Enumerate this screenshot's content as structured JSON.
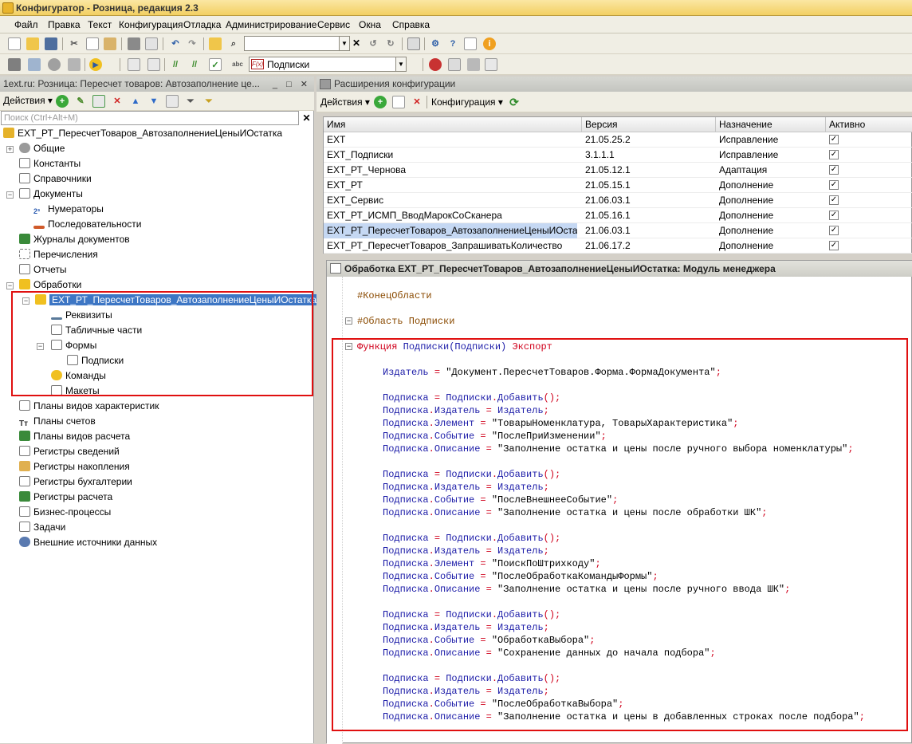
{
  "app": {
    "title": "Конфигуратор - Розница, редакция 2.3"
  },
  "menu": [
    "Файл",
    "Правка",
    "Текст",
    "Конфигурация",
    "Отладка",
    "Администрирование",
    "Сервис",
    "Окна",
    "Справка"
  ],
  "toolbar": {
    "subscriptions_combo": "Подписки",
    "fx_label": "F(x)"
  },
  "left_panel": {
    "title": "1ext.ru: Розница: Пересчет товаров: Автозаполнение це...",
    "actions_label": "Действия",
    "search_placeholder": "Поиск (Ctrl+Alt+M)",
    "root": "EXT_РТ_ПересчетТоваров_АвтозаполнениеЦеныИОстатка",
    "items": {
      "general": "Общие",
      "constants": "Константы",
      "catalogs": "Справочники",
      "documents": "Документы",
      "numerators": "Нумераторы",
      "sequences": "Последовательности",
      "doc_journals": "Журналы документов",
      "enums": "Перечисления",
      "reports": "Отчеты",
      "processing": "Обработки",
      "selected_processing": "EXT_РТ_ПересчетТоваров_АвтозаполнениеЦеныИОстатка",
      "attributes": "Реквизиты",
      "tabular_parts": "Табличные части",
      "forms": "Формы",
      "form_subscriptions": "Подписки",
      "commands": "Команды",
      "templates": "Макеты",
      "chart_char_types": "Планы видов характеристик",
      "chart_accounts": "Планы счетов",
      "chart_calc_types": "Планы видов расчета",
      "info_registers": "Регистры сведений",
      "accum_registers": "Регистры накопления",
      "accounting_registers": "Регистры бухгалтерии",
      "calc_registers": "Регистры расчета",
      "business_processes": "Бизнес-процессы",
      "tasks": "Задачи",
      "external_sources": "Внешние источники данных"
    }
  },
  "right_panel": {
    "title": "Расширения конфигурации",
    "actions_label": "Действия",
    "config_label": "Конфигурация",
    "columns": [
      "Имя",
      "Версия",
      "Назначение",
      "Активно"
    ],
    "rows": [
      {
        "name": "EXT",
        "version": "21.05.25.2",
        "purpose": "Исправление",
        "check": "✓"
      },
      {
        "name": "EXT_Подписки",
        "version": "3.1.1.1",
        "purpose": "Исправление",
        "check": "✓"
      },
      {
        "name": "EXT_РТ_Чернова",
        "version": "21.05.12.1",
        "purpose": "Адаптация",
        "check": "✓"
      },
      {
        "name": "EXT_РТ",
        "version": "21.05.15.1",
        "purpose": "Дополнение",
        "check": "✓"
      },
      {
        "name": "EXT_Сервис",
        "version": "21.06.03.1",
        "purpose": "Дополнение",
        "check": "✓"
      },
      {
        "name": "EXT_РТ_ИСМП_ВводМарокСоСканера",
        "version": "21.05.16.1",
        "purpose": "Дополнение",
        "check": "✓"
      },
      {
        "name": "EXT_РТ_ПересчетТоваров_АвтозаполнениеЦеныИОстатка",
        "version": "21.06.03.1",
        "purpose": "Дополнение",
        "check": "✓"
      },
      {
        "name": "EXT_РТ_ПересчетТоваров_ЗапрашиватьКоличество",
        "version": "21.06.17.2",
        "purpose": "Дополнение",
        "check": "✓"
      }
    ]
  },
  "code": {
    "title": "Обработка EXT_РТ_ПересчетТоваров_АвтозаполнениеЦеныИОстатка: Модуль менеджера",
    "end_region": "#КонецОбласти",
    "region": "#Область Подписки",
    "func_kw": "Функция",
    "func_name": "Подписки",
    "func_param": "(Подписки)",
    "export_kw": "Экспорт",
    "lines": {
      "l1": "Издатель = \"Документ.ПересчетТоваров.Форма.ФормаДокумента\";",
      "b1_1": "Подписка = Подписки.Добавить();",
      "b1_2": "Подписка.Издатель = Издатель;",
      "b1_3": "Подписка.Элемент = \"ТоварыНоменклатура, ТоварыХарактеристика\";",
      "b1_4": "Подписка.Событие = \"ПослеПриИзменении\";",
      "b1_5": "Подписка.Описание = \"Заполнение остатка и цены после ручного выбора номенклатуры\";",
      "b2_1": "Подписка = Подписки.Добавить();",
      "b2_2": "Подписка.Издатель = Издатель;",
      "b2_3": "Подписка.Событие = \"ПослеВнешнееСобытие\";",
      "b2_4": "Подписка.Описание = \"Заполнение остатка и цены после обработки ШК\";",
      "b3_1": "Подписка = Подписки.Добавить();",
      "b3_2": "Подписка.Издатель = Издатель;",
      "b3_3": "Подписка.Элемент = \"ПоискПоШтрихкоду\";",
      "b3_4": "Подписка.Событие = \"ПослеОбработкаКомандыФормы\";",
      "b3_5": "Подписка.Описание = \"Заполнение остатка и цены после ручного ввода ШК\";",
      "b4_1": "Подписка = Подписки.Добавить();",
      "b4_2": "Подписка.Издатель = Издатель;",
      "b4_3": "Подписка.Событие = \"ОбработкаВыбора\";",
      "b4_4": "Подписка.Описание = \"Сохранение данных до начала подбора\";",
      "b5_1": "Подписка = Подписки.Добавить();",
      "b5_2": "Подписка.Издатель = Издатель;",
      "b5_3": "Подписка.Событие = \"ПослеОбработкаВыбора\";",
      "b5_4": "Подписка.Описание = \"Заполнение остатка и цены в добавленных строках после подбора\";"
    }
  },
  "colors": {
    "selection": "#3d76c4",
    "highlight_box": "#e01010",
    "keyword": "#d0001b",
    "identifier": "#1c1ca8"
  }
}
